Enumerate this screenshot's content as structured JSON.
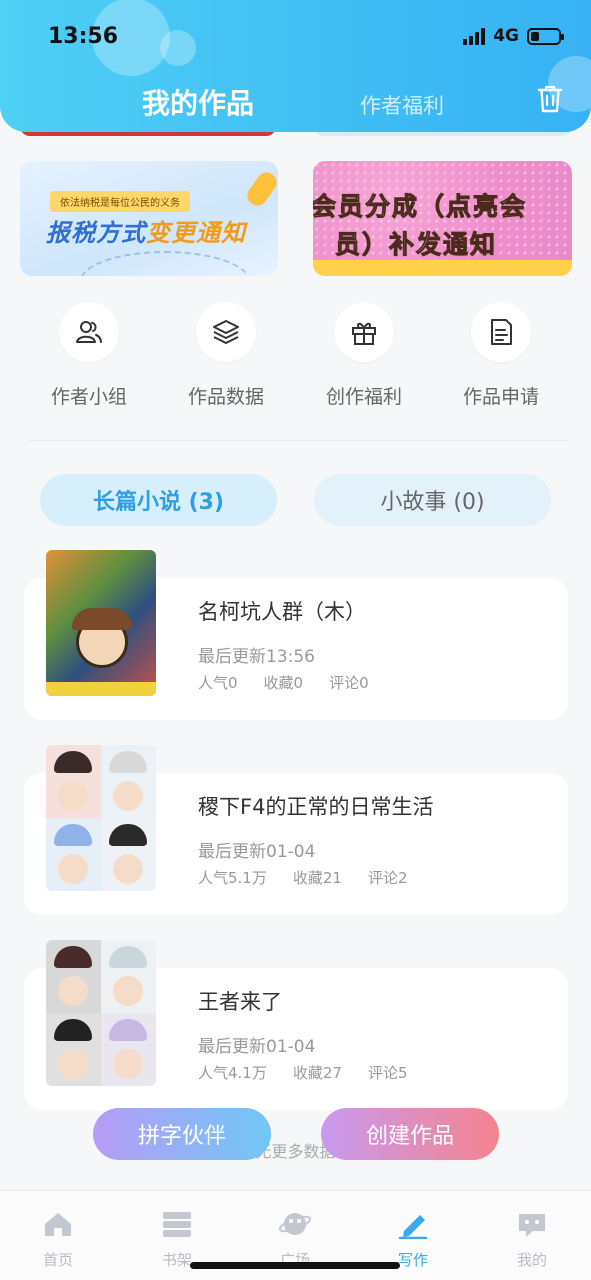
{
  "status": {
    "time": "13:56",
    "network": "4G"
  },
  "header": {
    "active_tab": "我的作品",
    "inactive_tab": "作者福利"
  },
  "banners": {
    "left": {
      "tag": "依法纳税是每位公民的义务",
      "title_a": "报税方式",
      "title_b": "变更通知"
    },
    "right": {
      "line1": "会员分成（点亮会",
      "line2": "员）补发通知"
    }
  },
  "quick": [
    {
      "label": "作者小组",
      "icon": "users-icon"
    },
    {
      "label": "作品数据",
      "icon": "layers-icon"
    },
    {
      "label": "创作福利",
      "icon": "gift-icon"
    },
    {
      "label": "作品申请",
      "icon": "document-icon"
    }
  ],
  "segments": {
    "long": "长篇小说 (3)",
    "short": "小故事 (0)"
  },
  "works": [
    {
      "title": "名柯坑人群（木）",
      "update": "最后更新13:56",
      "popularity": "人气0",
      "favorites": "收藏0",
      "comments": "评论0"
    },
    {
      "title": "稷下F4的正常的日常生活",
      "update": "最后更新01-04",
      "popularity": "人气5.1万",
      "favorites": "收藏21",
      "comments": "评论2"
    },
    {
      "title": "王者来了",
      "update": "最后更新01-04",
      "popularity": "人气4.1万",
      "favorites": "收藏27",
      "comments": "评论5"
    }
  ],
  "footer": {
    "no_more": "无更多数据",
    "partner_button": "拼字伙伴",
    "create_button": "创建作品"
  },
  "tabbar": [
    {
      "label": "首页",
      "icon": "home-icon"
    },
    {
      "label": "书架",
      "icon": "bookshelf-icon"
    },
    {
      "label": "广场",
      "icon": "planet-icon"
    },
    {
      "label": "写作",
      "icon": "pen-icon"
    },
    {
      "label": "我的",
      "icon": "chat-icon"
    }
  ],
  "colors": {
    "accent": "#38a9ea",
    "header_start": "#4fd0f5",
    "header_end": "#37b2f5"
  }
}
